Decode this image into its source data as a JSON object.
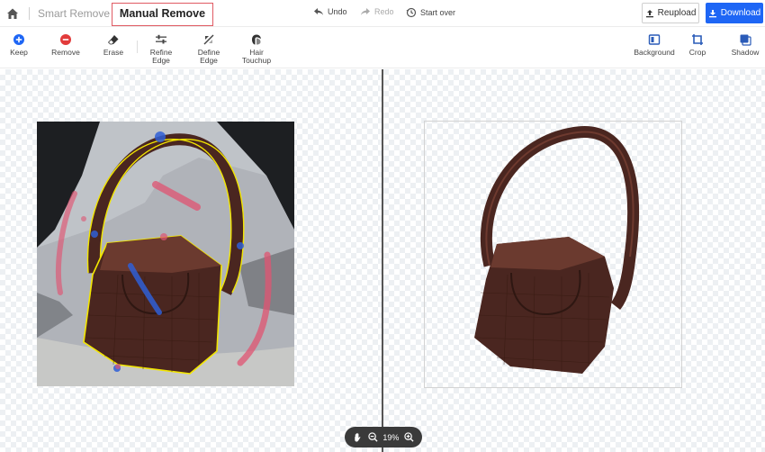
{
  "header": {
    "tabs": {
      "smart": "Smart Remove",
      "manual": "Manual Remove"
    },
    "history": {
      "undo": "Undo",
      "redo": "Redo",
      "start_over": "Start over"
    },
    "reupload": "Reupload",
    "download": "Download"
  },
  "toolbar": {
    "left": [
      {
        "label": "Keep",
        "icon": "plus-circle-icon"
      },
      {
        "label": "Remove",
        "icon": "minus-circle-icon"
      },
      {
        "label": "Erase",
        "icon": "eraser-icon"
      },
      {
        "label": "Refine Edge",
        "icon": "sliders-icon"
      },
      {
        "label": "Define Edge",
        "icon": "edge-icon"
      },
      {
        "label": "Hair Touchup",
        "icon": "hair-icon"
      }
    ],
    "right": [
      {
        "label": "Background",
        "icon": "background-icon"
      },
      {
        "label": "Crop",
        "icon": "crop-icon"
      },
      {
        "label": "Shadow",
        "icon": "shadow-icon"
      }
    ]
  },
  "zoom": {
    "level": "19%"
  },
  "colors": {
    "accent": "#1e66f5",
    "keep": "#1e66f5",
    "remove": "#e23b3b",
    "outline": "#f2e600",
    "bag": "#4a2620"
  }
}
